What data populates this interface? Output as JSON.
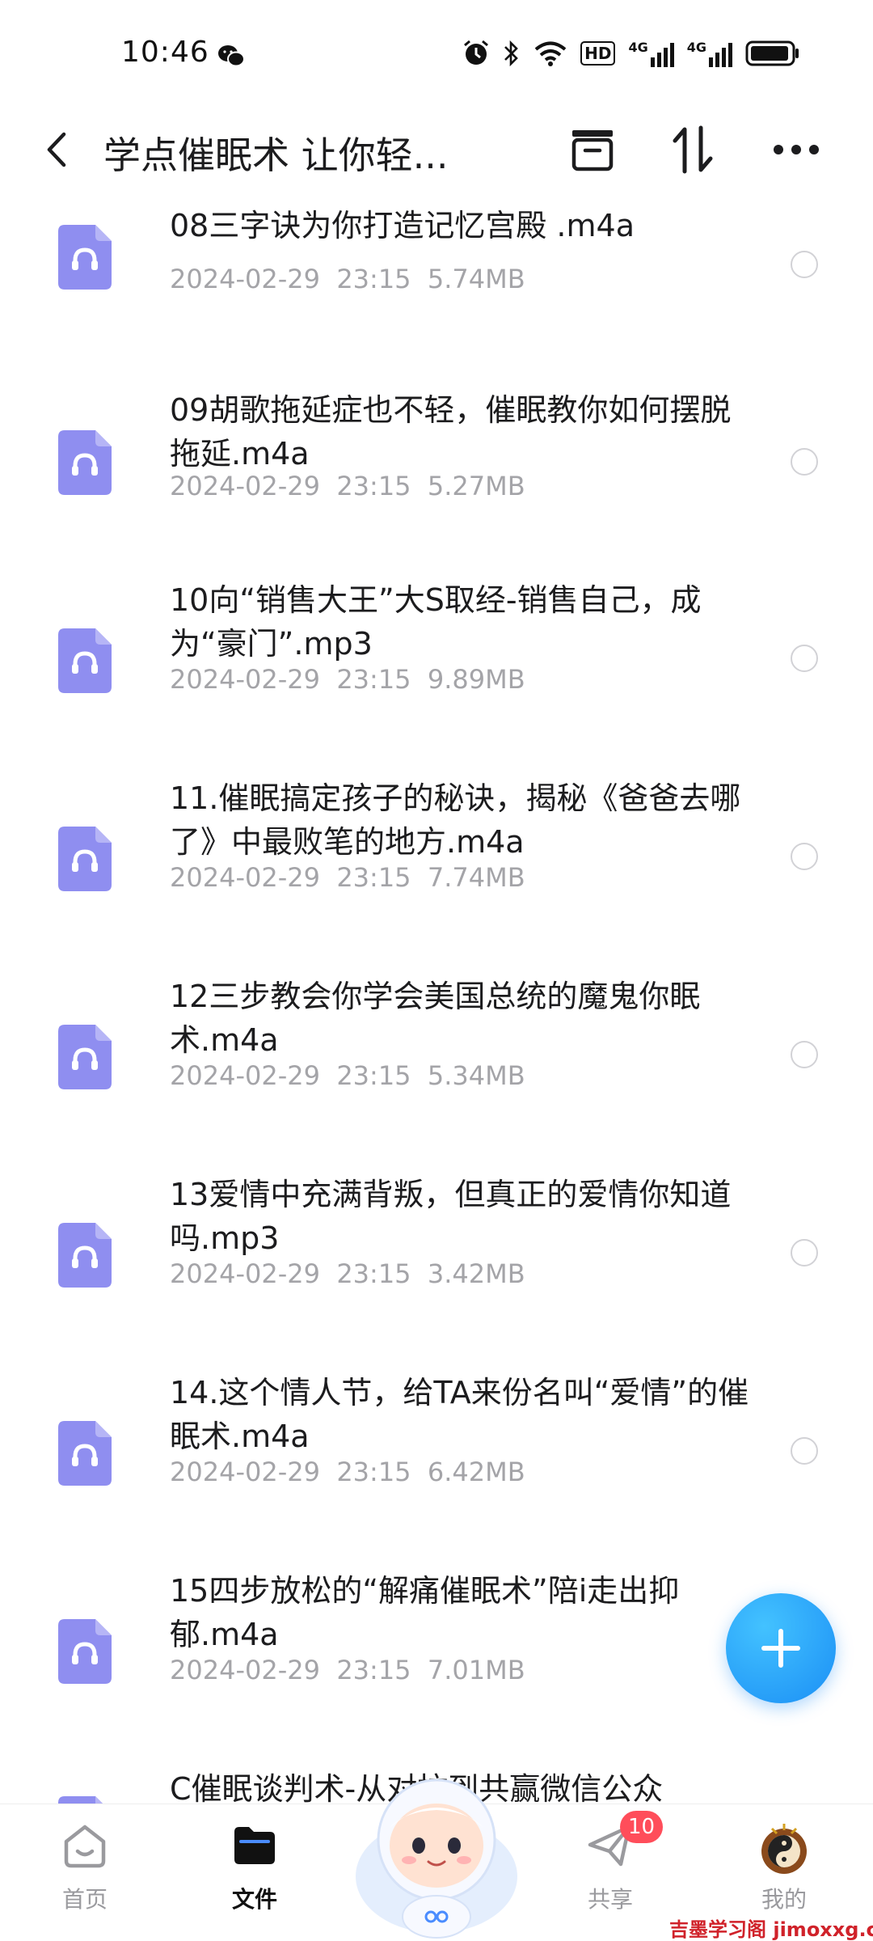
{
  "status_bar": {
    "time": "10:46",
    "wechat_icon": "wechat-icon",
    "hd_label": "HD",
    "network_1": "4G",
    "network_2": "4G"
  },
  "header": {
    "title": "学点催眠术 让你轻...",
    "back_icon": "back-arrow-icon",
    "actions": [
      "archive-icon",
      "sort-icon",
      "more-icon"
    ]
  },
  "files": [
    {
      "name": "08三字诀为你打造记忆宫殿 .m4a",
      "date": "2024-02-29",
      "time": "23:15",
      "size": "5.74MB",
      "icon": "audio-file-icon"
    },
    {
      "name": "09胡歌拖延症也不轻，催眠教你如何摆脱拖延.m4a",
      "date": "2024-02-29",
      "time": "23:15",
      "size": "5.27MB",
      "icon": "audio-file-icon"
    },
    {
      "name": "10向“销售大王”大S取经-销售自己，成为“豪门”.mp3",
      "date": "2024-02-29",
      "time": "23:15",
      "size": "9.89MB",
      "icon": "audio-file-icon"
    },
    {
      "name": "11.催眠搞定孩子的秘诀，揭秘《爸爸去哪了》中最败笔的地方.m4a",
      "date": "2024-02-29",
      "time": "23:15",
      "size": "7.74MB",
      "icon": "audio-file-icon"
    },
    {
      "name": "12三步教会你学会美国总统的魔鬼你眠术.m4a",
      "date": "2024-02-29",
      "time": "23:15",
      "size": "5.34MB",
      "icon": "audio-file-icon"
    },
    {
      "name": "13爱情中充满背叛，但真正的爱情你知道吗.mp3",
      "date": "2024-02-29",
      "time": "23:15",
      "size": "3.42MB",
      "icon": "audio-file-icon"
    },
    {
      "name": "14.这个情人节，给TA来份名叫“爱情”的催眠术.m4a",
      "date": "2024-02-29",
      "time": "23:15",
      "size": "6.42MB",
      "icon": "audio-file-icon"
    },
    {
      "name": "15四步放松的“解痛催眠术”陪i走出抑郁.m4a",
      "date": "2024-02-29",
      "time": "23:15",
      "size": "7.01MB",
      "icon": "audio-file-icon"
    },
    {
      "name": "C催眠谈判术-从对抗到共赢微信公众",
      "date": "",
      "time": "",
      "size": "",
      "icon": "audio-file-icon"
    }
  ],
  "fab": {
    "icon": "plus-icon"
  },
  "bottom_nav": {
    "items": [
      {
        "label": "首页",
        "icon": "home-icon",
        "active": false
      },
      {
        "label": "文件",
        "icon": "folder-icon",
        "active": true
      },
      {
        "label": "",
        "icon": "mascot-icon",
        "active": false
      },
      {
        "label": "共享",
        "icon": "paper-plane-icon",
        "active": false,
        "badge": "10"
      },
      {
        "label": "我的",
        "icon": "avatar-icon",
        "active": false
      }
    ]
  },
  "watermark": "吉墨学习阁 jimoxxg.com",
  "colors": {
    "accent": "#1b8ff5",
    "file_icon": "#8f8ef0",
    "meta_text": "#a4a4a8",
    "badge": "#ff4d5a"
  }
}
